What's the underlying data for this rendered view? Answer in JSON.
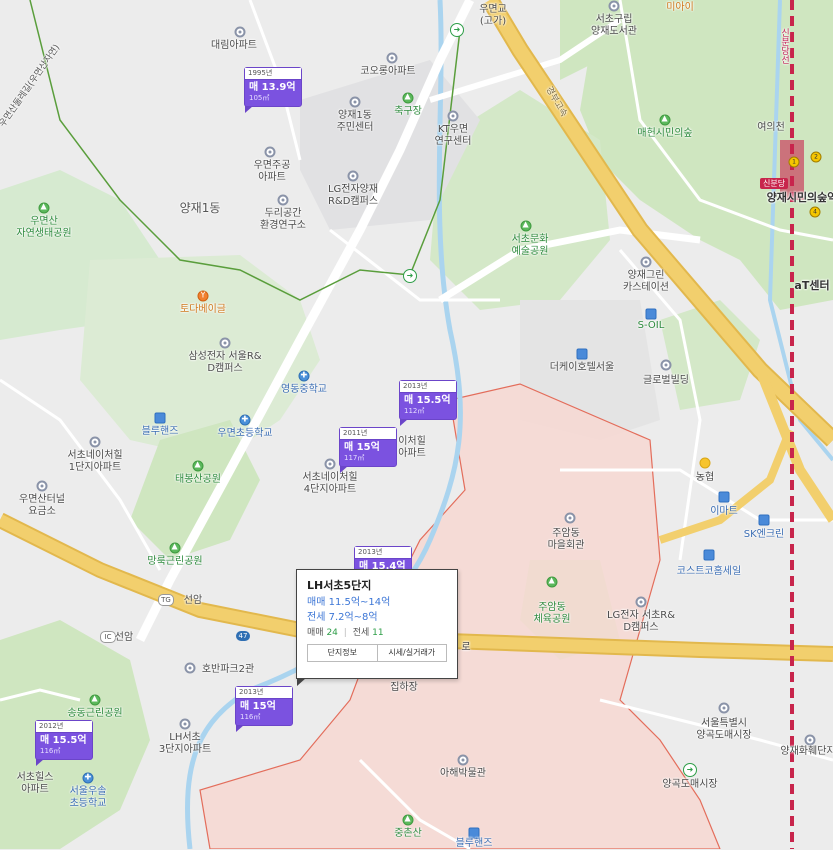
{
  "map": {
    "colors": {
      "background": "#ececec",
      "park": "#cfe6c0",
      "water": "#aad4ef",
      "highway": "#f2cf6d",
      "district_fill": "#f7d8d2",
      "district_line": "#e36d5b",
      "marker": "#7b52e0",
      "subway": "#c8254c",
      "hiking_trail": "#5a9e3c"
    },
    "labels": {
      "daerim_apt": "대림아파트",
      "kolon_apt": "코오롱아파트",
      "yangjae1_center": "양재1동\n주민센터",
      "chukgujang": "축구장",
      "kt_center": "KT우면\n연구센터",
      "woomyeon_apt": "우면주공\n아파트",
      "lg_rnd": "LG전자양재\nR&D캠퍼스",
      "duri_lab": "두리공간\n환경연구소",
      "yangjae1dong": "양재1동",
      "woomyeonsan_park": "우면산\n자연생태공원",
      "tofu_grill": "토다베이글",
      "samsung_rnd": "삼성전자 서울R&\nD캠퍼스",
      "yeongdong_ms": "영동중학교",
      "blue_hands": "블루핸즈",
      "woomyeon_es": "우면초등학교",
      "seocho_nechil1": "서초네이처힐\n1단지아파트",
      "taebongsan_park": "태봉산공원",
      "seocho_nechil4": "서초네이처힐\n4단지아파트",
      "nechil_partial": "이처힐\n아파트",
      "woomyeon_tunnel": "우면산터널\n요금소",
      "manggol_park": "망룩근린공원",
      "seoan": "선암",
      "seoan_ic": "선암",
      "hoban_park2": "호반파크2관",
      "songdong_park": "송동근린공원",
      "lh_seocho3": "LH서초\n3단지아파트",
      "seocho_hills": "서초힐스\n아파트",
      "seoul_woomyeon_es": "서울우솔\n초등학교",
      "woomyeongyo": "우면교\n(고가)",
      "seochogu_lib": "서초구립\n양재도서관",
      "maeheon_forest": "매헌시민의숲",
      "yeoui_stream": "여의천",
      "yangjae_station": "양재시민의숲역",
      "sinbundang": "신분당",
      "seocho_art": "서초문화\n예술공원",
      "yangjae_green": "양재그린\n카스테이션",
      "s_oil": "S-OIL",
      "the_k_hotel": "더케이호텔서울",
      "global_bldg": "글로벌빌딩",
      "at_center": "aT센터",
      "nonghyup": "농협",
      "emart": "이마트",
      "sk_energy": "SK엔크린",
      "costco": "코스트코홈세일",
      "juamdong_hall": "주암동\n마을회관",
      "juamdong_sports": "주암동\n체육공원",
      "lg_seocho": "LG전자 서초R&\nD캠퍼스",
      "seoul_market": "서울특별시\n양곡도매시장",
      "yangjae_flower": "양재화훼단지",
      "yanggok_market": "양곡도매시장",
      "ahae_museum": "아해박물관",
      "jungchunsan": "중촌산",
      "blue_hands2": "블루핸즈",
      "jiphajang": "집하장",
      "gyeongbu_expwy": "경부고속",
      "sinbundang_line": "신분당선",
      "trail_label": "우면산둘레길(우면산자연)",
      "maieon": "미아이",
      "yeoui_side": "여의천",
      "ro": "로"
    },
    "road_shields": {
      "route47": "47",
      "ic": "IC"
    }
  },
  "markers": [
    {
      "year": "1995년",
      "price": "매 13.9억",
      "area": "105㎡"
    },
    {
      "year": "2013년",
      "price": "매 15.5억",
      "area": "112㎡"
    },
    {
      "year": "2011년",
      "price": "매 15억",
      "area": "117㎡"
    },
    {
      "year": "2013년",
      "price": "매 15.4억",
      "area": ""
    },
    {
      "year": "2013년",
      "price": "매 15억",
      "area": "116㎡"
    },
    {
      "year": "2012년",
      "price": "매 15.5억",
      "area": "116㎡"
    }
  ],
  "popup": {
    "title": "LH서초5단지",
    "sale_range": "매매 11.5억~14억",
    "jeonse_range": "전세 7.2억~8억",
    "sale_label": "매매",
    "sale_count": "24",
    "jeonse_label": "전세",
    "jeonse_count": "11",
    "button_info": "단지정보",
    "button_price": "시세/실거래가"
  }
}
